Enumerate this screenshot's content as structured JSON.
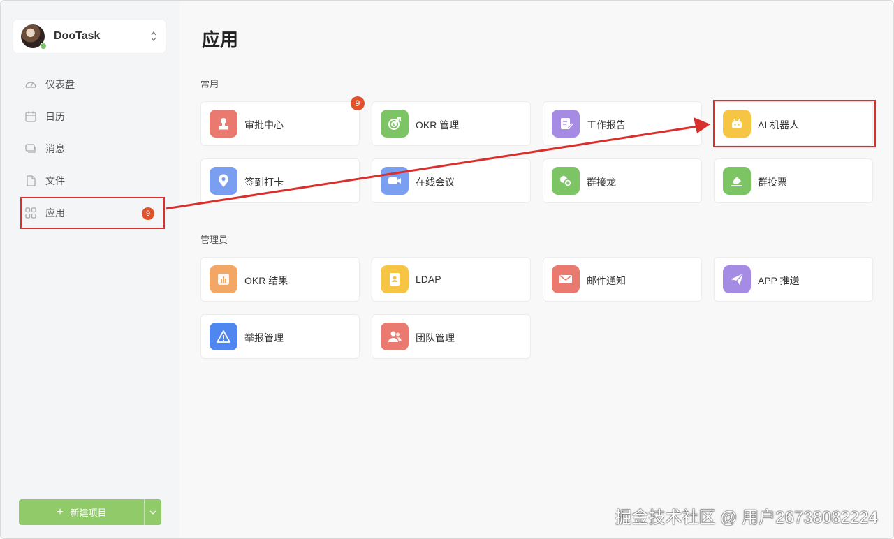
{
  "user": {
    "name": "DooTask",
    "status": "online"
  },
  "sidebar": {
    "items": [
      {
        "label": "仪表盘",
        "icon": "dashboard-icon"
      },
      {
        "label": "日历",
        "icon": "calendar-icon"
      },
      {
        "label": "消息",
        "icon": "message-icon"
      },
      {
        "label": "文件",
        "icon": "file-icon"
      },
      {
        "label": "应用",
        "icon": "apps-icon",
        "badge": "9",
        "active": true
      }
    ],
    "new_project_label": "新建项目"
  },
  "main": {
    "title": "应用",
    "sections": [
      {
        "title": "常用",
        "apps": [
          {
            "label": "审批中心",
            "icon": "approval-stamp-icon",
            "color": "#ea7a6f",
            "badge": "9"
          },
          {
            "label": "OKR 管理",
            "icon": "target-icon",
            "color": "#7dc465"
          },
          {
            "label": "工作报告",
            "icon": "report-edit-icon",
            "color": "#a58be4"
          },
          {
            "label": "AI 机器人",
            "icon": "robot-icon",
            "color": "#f6c544"
          },
          {
            "label": "签到打卡",
            "icon": "location-pin-icon",
            "color": "#7a9ff0"
          },
          {
            "label": "在线会议",
            "icon": "video-camera-icon",
            "color": "#7a9ff0"
          },
          {
            "label": "群接龙",
            "icon": "group-chain-icon",
            "color": "#7dc465"
          },
          {
            "label": "群投票",
            "icon": "vote-icon",
            "color": "#7dc465"
          }
        ]
      },
      {
        "title": "管理员",
        "apps": [
          {
            "label": "OKR 结果",
            "icon": "bar-chart-icon",
            "color": "#f2a764"
          },
          {
            "label": "LDAP",
            "icon": "directory-book-icon",
            "color": "#f6c544"
          },
          {
            "label": "邮件通知",
            "icon": "mail-icon",
            "color": "#ea7a6f"
          },
          {
            "label": "APP 推送",
            "icon": "paper-plane-icon",
            "color": "#a58be4"
          },
          {
            "label": "举报管理",
            "icon": "warning-icon",
            "color": "#4f86f0"
          },
          {
            "label": "团队管理",
            "icon": "team-users-icon",
            "color": "#ea7a6f"
          }
        ]
      }
    ]
  },
  "watermark": "掘金技术社区 @ 用户26738082224",
  "colors": {
    "annotation": "#d9302d",
    "badge": "#e0522b",
    "accent_green": "#87c65a"
  }
}
